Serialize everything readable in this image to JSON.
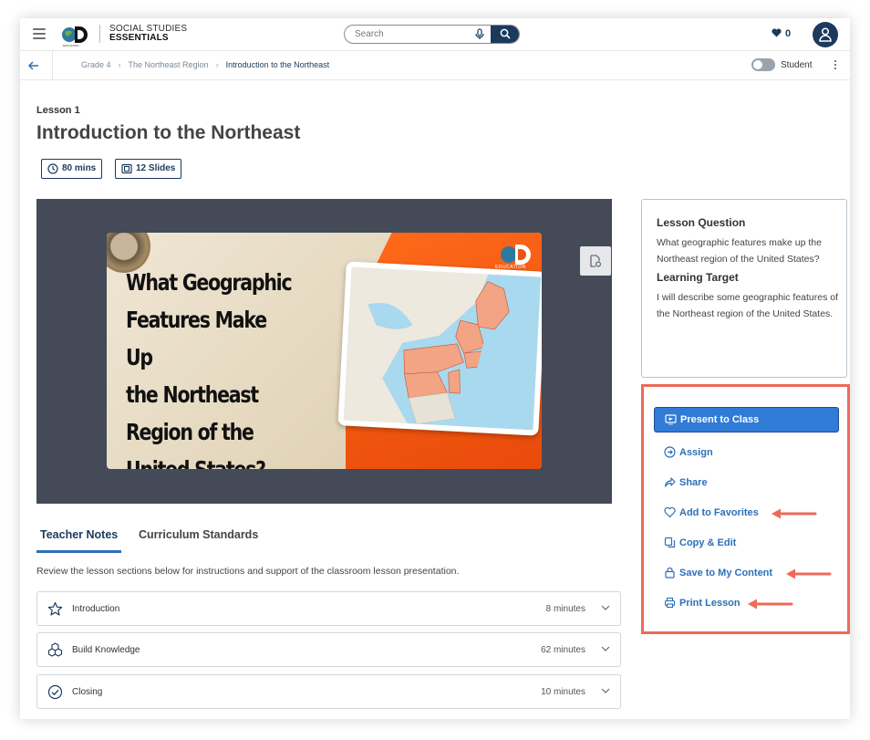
{
  "header": {
    "logo_line1": "SOCIAL STUDIES",
    "logo_line2": "ESSENTIALS",
    "search_placeholder": "Search",
    "favorites_count": "0"
  },
  "breadcrumb": {
    "items": [
      "Grade 4",
      "The Northeast Region",
      "Introduction to the Northeast"
    ],
    "toggle_label": "Student"
  },
  "lesson": {
    "number": "Lesson 1",
    "title": "Introduction to the Northeast",
    "duration": "80 mins",
    "slides": "12 Slides"
  },
  "slide": {
    "title_lines": [
      "What Geographic",
      "Features Make Up",
      "the Northeast",
      "Region of the",
      "United States?"
    ],
    "brand_text": "EDUCATION"
  },
  "tabs": {
    "notes": "Teacher Notes",
    "standards": "Curriculum Standards",
    "description": "Review the lesson sections below for instructions and support of the classroom lesson presentation."
  },
  "sections": [
    {
      "name": "Introduction",
      "time": "8 minutes",
      "icon": "star-icon"
    },
    {
      "name": "Build Knowledge",
      "time": "62 minutes",
      "icon": "blocks-icon"
    },
    {
      "name": "Closing",
      "time": "10 minutes",
      "icon": "check-circle-icon"
    }
  ],
  "info": {
    "question_heading": "Lesson Question",
    "question_text": "What geographic features make up the Northeast region of the United States?",
    "target_heading": "Learning Target",
    "target_text": "I will describe some geographic features of the Northeast region of the United States."
  },
  "actions": {
    "present": "Present to Class",
    "assign": "Assign",
    "share": "Share",
    "favorites": "Add to Favorites",
    "copy": "Copy & Edit",
    "save": "Save to My Content",
    "print": "Print Lesson"
  },
  "colors": {
    "navy": "#1b3a5c",
    "accent_blue": "#2d6fb8",
    "present_blue": "#2f7bd6",
    "highlight_red": "#ee6a58"
  }
}
